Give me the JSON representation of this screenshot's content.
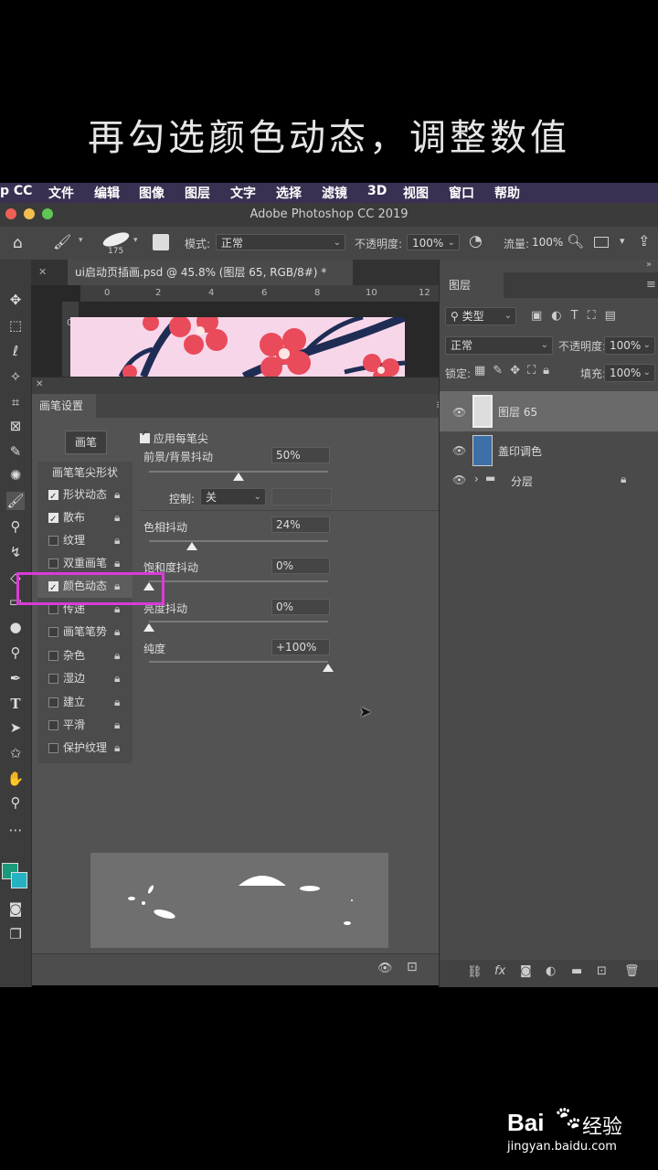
{
  "caption": "再勾选颜色动态，调整数值",
  "menubar": {
    "items": [
      "p CC",
      "文件",
      "编辑",
      "图像",
      "图层",
      "文字",
      "选择",
      "滤镜",
      "3D",
      "视图",
      "窗口",
      "帮助"
    ]
  },
  "window": {
    "title": "Adobe Photoshop CC 2019"
  },
  "options": {
    "brush_size": "175",
    "mode_label": "模式:",
    "mode_value": "正常",
    "opacity_label": "不透明度:",
    "opacity_value": "100%",
    "flow_label": "流量:",
    "flow_value": "100%"
  },
  "document": {
    "tab_title": "ui启动页插画.psd @ 45.8% (图层 65, RGB/8#) *",
    "ruler_ticks": [
      "0",
      "2",
      "4",
      "6",
      "8",
      "10",
      "12"
    ],
    "vruler_tick": "0"
  },
  "brush_panel": {
    "title": "画笔设置",
    "brush_button": "画笔",
    "tip_shape": "画笔笔尖形状",
    "apply_per_tip": "应用每笔尖",
    "items": [
      {
        "label": "形状动态",
        "checked": true
      },
      {
        "label": "散布",
        "checked": true
      },
      {
        "label": "纹理",
        "checked": false
      },
      {
        "label": "双重画笔",
        "checked": false
      },
      {
        "label": "颜色动态",
        "checked": true
      },
      {
        "label": "传递",
        "checked": false
      },
      {
        "label": "画笔笔势",
        "checked": false
      },
      {
        "label": "杂色",
        "checked": false
      },
      {
        "label": "湿边",
        "checked": false
      },
      {
        "label": "建立",
        "checked": false
      },
      {
        "label": "平滑",
        "checked": false
      },
      {
        "label": "保护纹理",
        "checked": false
      }
    ],
    "params": {
      "fg_bg_label": "前景/背景抖动",
      "fg_bg_value": "50%",
      "control_label": "控制:",
      "control_value": "关",
      "hue_label": "色相抖动",
      "hue_value": "24%",
      "saturation_label": "饱和度抖动",
      "saturation_value": "0%",
      "brightness_label": "亮度抖动",
      "brightness_value": "0%",
      "purity_label": "纯度",
      "purity_value": "+100%"
    },
    "slider_levels": {
      "fg_bg": 0.5,
      "hue": 0.24,
      "saturation": 0.0,
      "brightness": 0.0,
      "purity": 1.0
    }
  },
  "layers_panel": {
    "tab": "图层",
    "filter_label": "类型",
    "blend_mode": "正常",
    "opacity_label": "不透明度:",
    "opacity_value": "100%",
    "lock_label": "锁定:",
    "fill_label": "填充:",
    "fill_value": "100%",
    "layers": [
      {
        "name": "图层 65",
        "selected": true
      },
      {
        "name": "盖印调色",
        "selected": false
      },
      {
        "name": "分层",
        "selected": false
      }
    ]
  },
  "watermark": {
    "brand": "Bai",
    "brand2": "经验",
    "url": "jingyan.baidu.com"
  },
  "colors": {
    "highlight": "#d93cd6",
    "menubar": "#3a3052",
    "foreground": "#1a9a7a",
    "background": "#25b3c4"
  }
}
